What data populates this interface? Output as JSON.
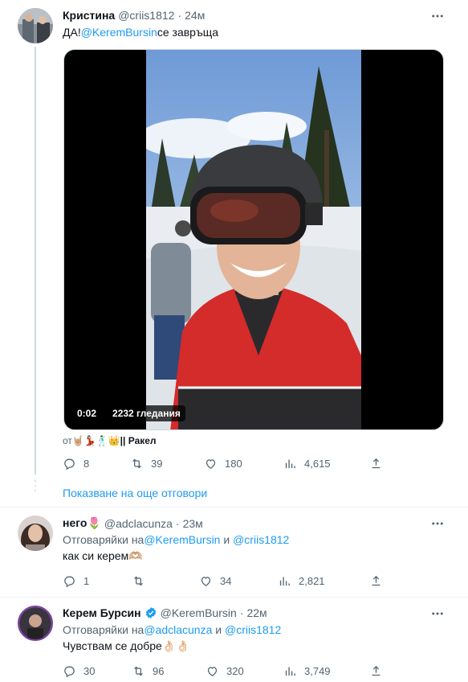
{
  "tweet1": {
    "name": "Кристина",
    "handle": "@criis1812",
    "dot": "·",
    "time": "24м",
    "text_pre": "ДА!",
    "mention": "@KeremBursin",
    "text_post": "се завръща",
    "video": {
      "time": "0:02",
      "views": "2232 гледания"
    },
    "source_pre": "от",
    "source_emoji": "🤘🏼💃🏻🕺🏻👑",
    "source_post": "|| Ракел",
    "stats": {
      "replies": "8",
      "reposts": "39",
      "likes": "180",
      "views": "4,615"
    }
  },
  "show_more": "Показване на още отговори",
  "tweet2": {
    "name": "него🌷",
    "handle": "@adclacunza",
    "dot": "·",
    "time": "23м",
    "reply_to_pre": "Отговаряйки на",
    "reply_mention1": "@KeremBursin",
    "reply_and": " и ",
    "reply_mention2": "@criis1812",
    "text": "как си керем🫶🏼",
    "stats": {
      "replies": "1",
      "reposts": "",
      "likes": "34",
      "views": "2,821"
    }
  },
  "tweet3": {
    "name": "Керем Бурсин",
    "handle": "@KeremBursin",
    "dot": "·",
    "time": "22м",
    "reply_to_pre": "Отговаряйки на",
    "reply_mention1": "@adclacunza",
    "reply_and": " и ",
    "reply_mention2": "@criis1812",
    "text": "Чувствам се добре👌🏻👌🏻",
    "stats": {
      "replies": "30",
      "reposts": "96",
      "likes": "320",
      "views": "3,749"
    }
  },
  "colors": {
    "link": "#1d9bf0",
    "muted": "#536471",
    "verified": "#1d9bf0"
  },
  "icons": [
    "reply-icon",
    "repost-icon",
    "like-icon",
    "views-icon",
    "share-icon",
    "more-icon",
    "verified-icon"
  ]
}
